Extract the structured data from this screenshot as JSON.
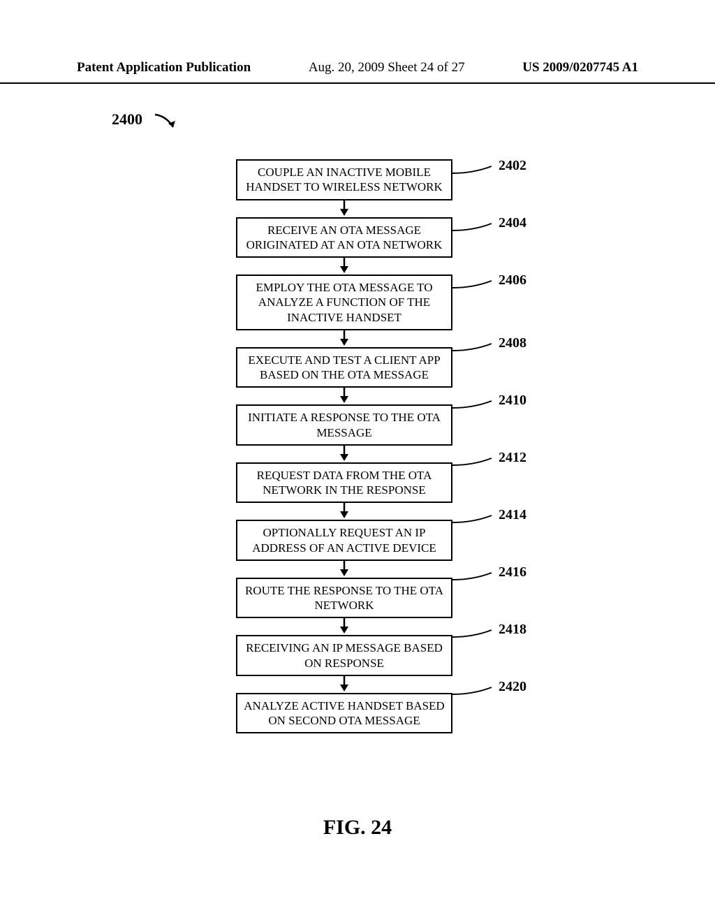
{
  "header": {
    "left": "Patent Application Publication",
    "mid": "Aug. 20, 2009  Sheet 24 of 27",
    "right": "US 2009/0207745 A1"
  },
  "figure": {
    "number_label": "2400",
    "caption": "FIG. 24"
  },
  "chart_data": {
    "type": "flowchart",
    "title": "FIG. 24",
    "nodes": [
      {
        "id": "2402",
        "label": "COUPLE AN INACTIVE MOBILE HANDSET TO WIRELESS NETWORK"
      },
      {
        "id": "2404",
        "label": "RECEIVE AN OTA MESSAGE ORIGINATED AT AN OTA NETWORK"
      },
      {
        "id": "2406",
        "label": "EMPLOY THE OTA MESSAGE TO ANALYZE A FUNCTION OF THE INACTIVE HANDSET"
      },
      {
        "id": "2408",
        "label": "EXECUTE AND TEST A CLIENT APP BASED ON THE OTA MESSAGE"
      },
      {
        "id": "2410",
        "label": "INITIATE A RESPONSE TO THE OTA MESSAGE"
      },
      {
        "id": "2412",
        "label": "REQUEST DATA FROM THE OTA NETWORK IN THE RESPONSE"
      },
      {
        "id": "2414",
        "label": "OPTIONALLY REQUEST AN IP ADDRESS OF AN ACTIVE DEVICE"
      },
      {
        "id": "2416",
        "label": "ROUTE THE RESPONSE TO THE OTA NETWORK"
      },
      {
        "id": "2418",
        "label": "RECEIVING AN IP MESSAGE BASED ON RESPONSE"
      },
      {
        "id": "2420",
        "label": "ANALYZE ACTIVE HANDSET BASED ON SECOND OTA MESSAGE"
      }
    ],
    "edges": [
      [
        "2402",
        "2404"
      ],
      [
        "2404",
        "2406"
      ],
      [
        "2406",
        "2408"
      ],
      [
        "2408",
        "2410"
      ],
      [
        "2410",
        "2412"
      ],
      [
        "2412",
        "2414"
      ],
      [
        "2414",
        "2416"
      ],
      [
        "2416",
        "2418"
      ],
      [
        "2418",
        "2420"
      ]
    ]
  }
}
